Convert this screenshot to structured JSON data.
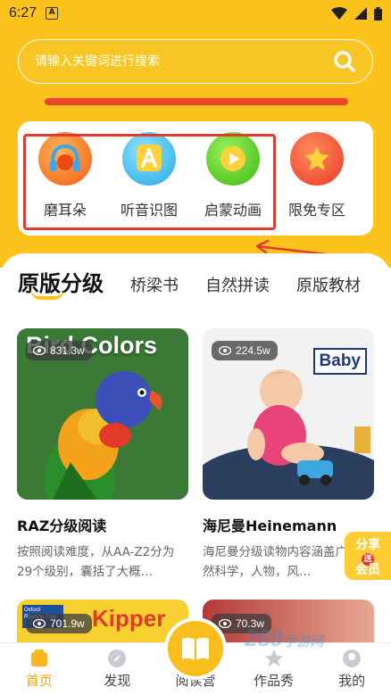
{
  "status": {
    "time": "6:27",
    "notif": "A"
  },
  "search": {
    "placeholder": "请输入关键词进行搜索"
  },
  "shortcuts": [
    {
      "label": "磨耳朵",
      "icon": "headphones-icon",
      "color": "#F26A1B"
    },
    {
      "label": "听音识图",
      "icon": "letter-a-icon",
      "color": "#2EB7E8"
    },
    {
      "label": "启蒙动画",
      "icon": "play-icon",
      "color": "#4CC417"
    },
    {
      "label": "限免专区",
      "icon": "star-badge-icon",
      "color": "#F0452E"
    }
  ],
  "tabs": [
    "原版分级",
    "桥梁书",
    "自然拼读",
    "原版教材"
  ],
  "cards": [
    {
      "cover_text": "Bird Colors",
      "views": "831.3w",
      "title": "RAZ分级阅读",
      "desc": "按照阅读难度，从AA-Z2分为29个级别，囊括了大概…"
    },
    {
      "cover_text": "Baby",
      "views": "224.5w",
      "title": "海尼曼Heinemann",
      "desc": "海尼曼分级读物内容涵盖广，自然科学，人物，风…"
    }
  ],
  "bottom_cards": [
    {
      "views": "701.9w",
      "cover_text": "Kipper",
      "small_text": "Oxford Reading Tree"
    },
    {
      "views": "70.3w"
    }
  ],
  "share_badge": {
    "top": "分享",
    "gift": "送",
    "bottom": "会员"
  },
  "nav": [
    {
      "label": "首页",
      "icon": "home-icon"
    },
    {
      "label": "发现",
      "icon": "compass-icon"
    },
    {
      "label": "阅读营",
      "icon": "book-icon"
    },
    {
      "label": "作品秀",
      "icon": "star-icon"
    },
    {
      "label": "我的",
      "icon": "user-icon"
    }
  ],
  "watermark": {
    "main": "289",
    "sub": "手游网"
  },
  "colors": {
    "brand_yellow": "#FBC31C",
    "highlight_red": "#E23A2E",
    "active_nav": "#F4A300"
  }
}
